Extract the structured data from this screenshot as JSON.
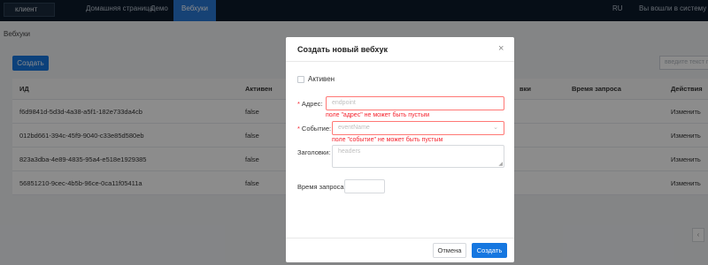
{
  "topbar": {
    "client": "клиент",
    "nav": [
      "Домашняя страница",
      "Демо",
      "Вебхуки"
    ],
    "lang": "RU",
    "login_text": "Вы вошли в систему как"
  },
  "page": {
    "title": "Вебхуки",
    "create_label": "Создать",
    "search_placeholder": "введите текст п"
  },
  "table": {
    "headers": {
      "id": "ИД",
      "active": "Активен",
      "changed": "вки",
      "request_time": "Время запроса",
      "actions": "Действия"
    },
    "rows": [
      {
        "id": "f6d9841d-5d3d-4a38-a5f1-182e733da4cb",
        "active": "false",
        "action": "Изменить"
      },
      {
        "id": "012bd661-394c-45f9-9040-c33e85d580eb",
        "active": "false",
        "action": "Изменить"
      },
      {
        "id": "823a3dba-4e89-4835-95a4-e518e1929385",
        "active": "false",
        "action": "Изменить"
      },
      {
        "id": "56851210-9cec-4b5b-96ce-0ca11f05411a",
        "active": "false",
        "action": "Изменить"
      }
    ]
  },
  "modal": {
    "title": "Создать новый вебхук",
    "active_label": "Активен",
    "address_label": "Адрес:",
    "address_placeholder": "endpoint",
    "address_error": "поле \"адрес\" не может быть пустым",
    "event_label": "Событие:",
    "event_placeholder": "eventName",
    "event_error": "поле \"событие\" не может быть пустым",
    "headers_label": "Заголовки:",
    "headers_placeholder": "headers",
    "request_time_label": "Время запроса:",
    "cancel_label": "Отмена",
    "create_label": "Создать",
    "required_mark": "*",
    "close_glyph": "×"
  },
  "icons": [
    "close-icon",
    "chevron-down-icon",
    "resize-handle-icon",
    "pager-prev-icon"
  ],
  "colors": {
    "primary": "#1677e0",
    "error": "#f5222d",
    "topbar": "#0b1a2b",
    "nav_active": "#2878d6"
  }
}
